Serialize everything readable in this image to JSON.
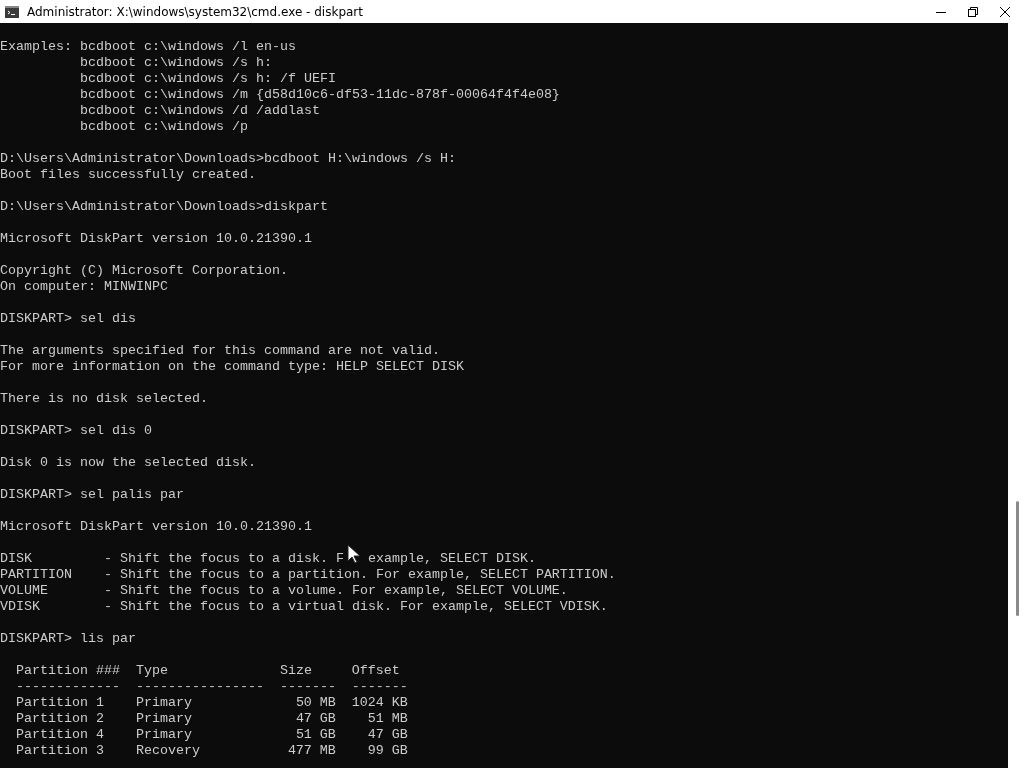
{
  "window": {
    "title": "Administrator: X:\\windows\\system32\\cmd.exe - diskpart"
  },
  "console": {
    "blocks": [
      [
        "Examples: bcdboot c:\\windows /l en-us",
        "          bcdboot c:\\windows /s h:",
        "          bcdboot c:\\windows /s h: /f UEFI",
        "          bcdboot c:\\windows /m {d58d10c6-df53-11dc-878f-00064f4f4e08}",
        "          bcdboot c:\\windows /d /addlast",
        "          bcdboot c:\\windows /p"
      ],
      [
        "D:\\Users\\Administrator\\Downloads>bcdboot H:\\windows /s H:",
        "Boot files successfully created."
      ],
      [
        "D:\\Users\\Administrator\\Downloads>diskpart"
      ],
      [
        "Microsoft DiskPart version 10.0.21390.1"
      ],
      [
        "Copyright (C) Microsoft Corporation.",
        "On computer: MINWINPC"
      ],
      [
        "DISKPART> sel dis"
      ],
      [
        "The arguments specified for this command are not valid.",
        "For more information on the command type: HELP SELECT DISK"
      ],
      [
        "There is no disk selected."
      ],
      [
        "DISKPART> sel dis 0"
      ],
      [
        "Disk 0 is now the selected disk."
      ],
      [
        "DISKPART> sel palis par"
      ],
      [
        "Microsoft DiskPart version 10.0.21390.1"
      ],
      [
        [
          "DISK         - Shift the focus to a disk. F",
          "example, SELECT DISK."
        ],
        "PARTITION    - Shift the focus to a partition. For example, SELECT PARTITION.",
        "VOLUME       - Shift the focus to a volume. For example, SELECT VOLUME.",
        "VDISK        - Shift the focus to a virtual disk. For example, SELECT VDISK."
      ],
      [
        "DISKPART> lis par"
      ]
    ],
    "table": {
      "columns": [
        "Partition ###",
        "Type",
        "Size",
        "Offset"
      ],
      "separators": [
        "-------------",
        "----------------",
        "-------",
        "-------"
      ],
      "rows": [
        [
          "Partition 1",
          "Primary",
          "50 MB",
          "1024 KB"
        ],
        [
          "Partition 2",
          "Primary",
          "47 GB",
          "51 MB"
        ],
        [
          "Partition 4",
          "Primary",
          "51 GB",
          "47 GB"
        ],
        [
          "Partition 3",
          "Recovery",
          "477 MB",
          "99 GB"
        ]
      ]
    }
  }
}
